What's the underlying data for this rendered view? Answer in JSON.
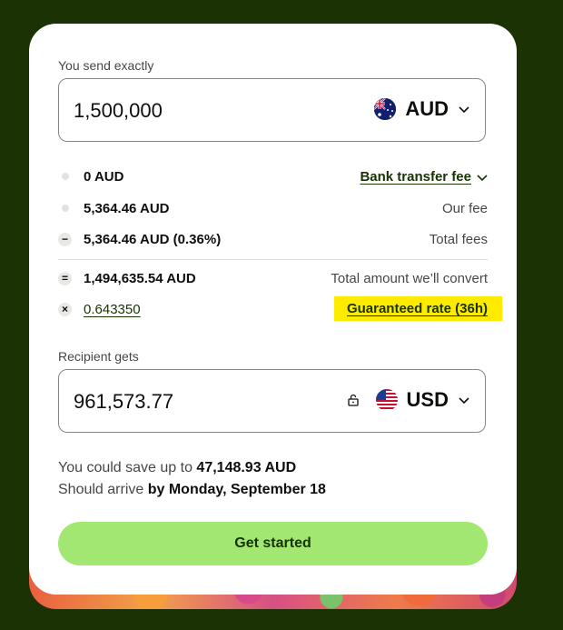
{
  "send": {
    "label": "You send exactly",
    "amount": "1,500,000",
    "currency": "AUD"
  },
  "fees": [
    {
      "value": "0 AUD",
      "label": "Bank transfer fee",
      "marker": "dot"
    },
    {
      "value": "5,364.46 AUD",
      "label": "Our fee",
      "marker": "dot"
    },
    {
      "value": "5,364.46 AUD (0.36%)",
      "label": "Total fees",
      "marker": "−"
    }
  ],
  "convert": {
    "value": "1,494,635.54 AUD",
    "label": "Total amount we’ll convert",
    "marker": "="
  },
  "rate": {
    "value": "0.643350",
    "label": "Guaranteed rate (36h)",
    "marker": "×",
    "highlight": "#ffeb00"
  },
  "recipient": {
    "label": "Recipient gets",
    "amount": "961,573.77",
    "currency": "USD"
  },
  "savings": {
    "prefix": "You could save up to",
    "amount": "47,148.93 AUD"
  },
  "arrival": {
    "prefix": "Should arrive",
    "when": "by Monday, September 18"
  },
  "cta": {
    "label": "Get started"
  },
  "colors": {
    "background": "#1b3205",
    "button": "#a2e771",
    "text": "#0e0f0c"
  }
}
